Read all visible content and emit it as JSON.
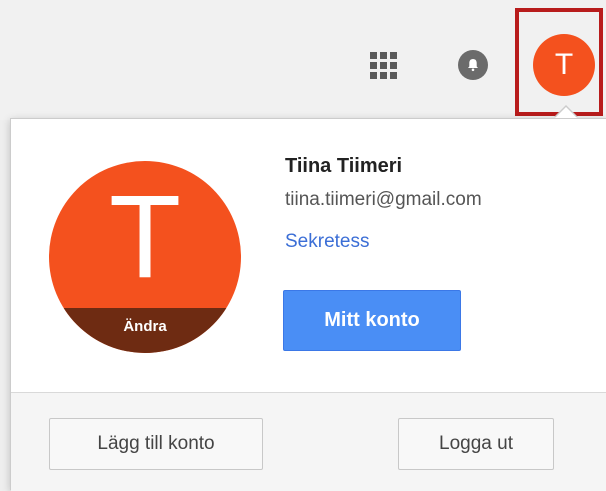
{
  "header": {
    "apps_icon": "apps-grid-icon",
    "notifications_icon": "bell-icon",
    "avatar_initial": "T"
  },
  "account_popup": {
    "avatar_initial": "T",
    "change_photo_label": "Ändra",
    "name": "Tiina Tiimeri",
    "email": "tiina.tiimeri@gmail.com",
    "privacy_link": "Sekretess",
    "my_account_button": "Mitt konto",
    "add_account_button": "Lägg till konto",
    "sign_out_button": "Logga ut"
  },
  "colors": {
    "avatar": "#f4511e",
    "avatar_change_band": "#6e2b12",
    "primary_button": "#4a8ef5",
    "link": "#3b6ed6",
    "highlight_box": "#b81c1c"
  }
}
